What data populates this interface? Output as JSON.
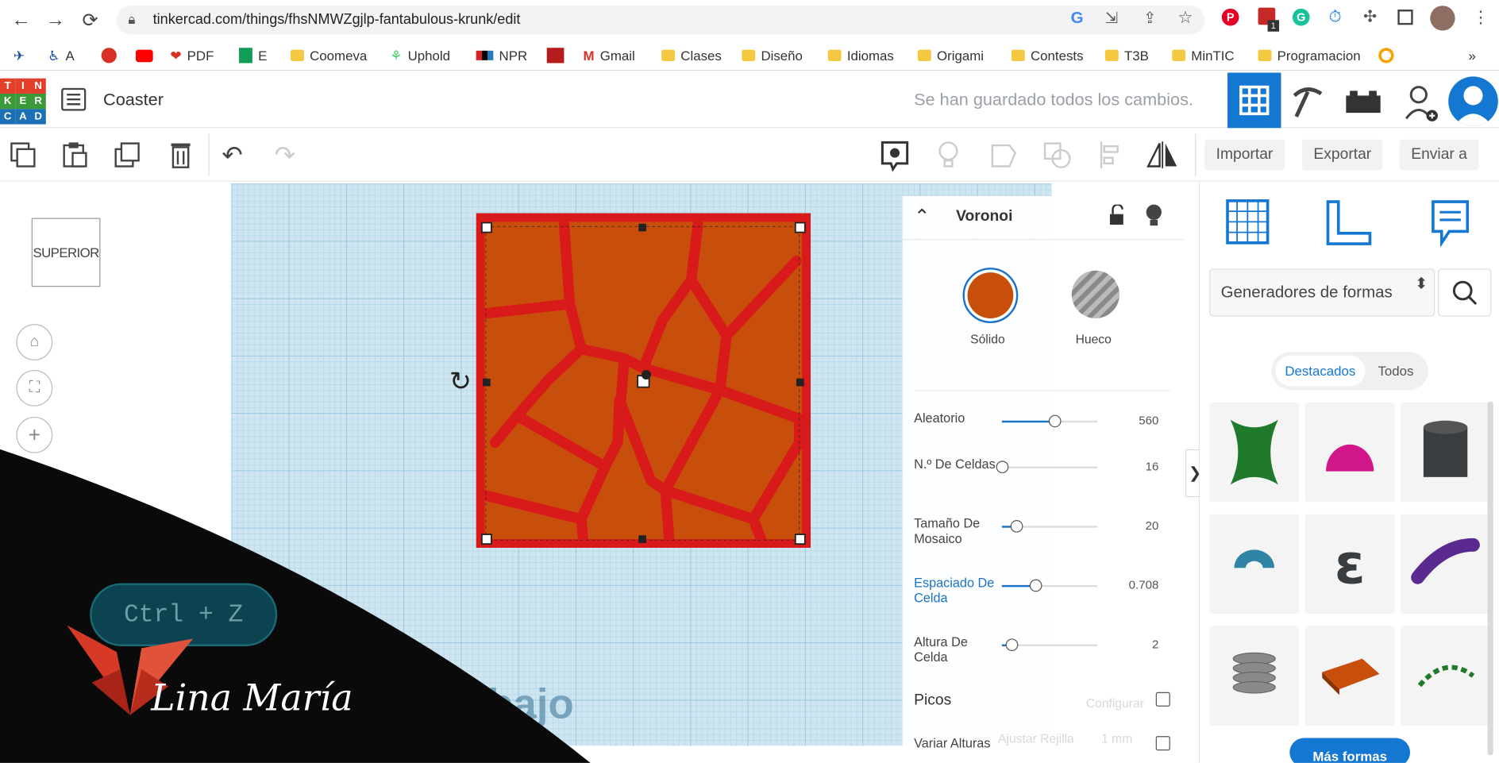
{
  "browser": {
    "url": "tinkercad.com/things/fhsNMWZgjlp-fantabulous-krunk/edit",
    "bookmarks": [
      "A",
      "PDF",
      "E",
      "Coomeva",
      "Uphold",
      "NPR",
      "Gmail",
      "Clases",
      "Diseño",
      "Idiomas",
      "Origami",
      "Contests",
      "T3B",
      "MinTIC",
      "Programacion"
    ],
    "more_bookmarks": "»",
    "badge": "1"
  },
  "app": {
    "logo_letters": [
      "T",
      "I",
      "N",
      "K",
      "E",
      "R",
      "C",
      "A",
      "D"
    ],
    "logo_colors": [
      "#e2402a",
      "#e2402a",
      "#e2402a",
      "#3a9a3a",
      "#3a9a3a",
      "#3a9a3a",
      "#1a6fb5",
      "#1a6fb5",
      "#1a6fb5"
    ],
    "title": "Coaster",
    "save_status": "Se han guardado todos los cambios.",
    "accent": "#1477d1"
  },
  "toolbar": {
    "import": "Importar",
    "export": "Exportar",
    "send": "Enviar a"
  },
  "workspace": {
    "viewcube": "SUPERIOR",
    "workplane_label": "Plano de trabajo",
    "shape_color": "#c84f0b",
    "frame_color": "#d81a1a"
  },
  "inspector": {
    "title": "Voronoi",
    "solid": "Sólido",
    "hole": "Hueco",
    "params": [
      {
        "label": "Aleatorio",
        "value": "560",
        "level": 0.55
      },
      {
        "label": "N.º De Celdas",
        "value": "16",
        "level": 0.0
      },
      {
        "label": "Tamaño De Mosaico",
        "value": "20",
        "level": 0.15
      },
      {
        "label": "Espaciado De Celda",
        "value": "0.708",
        "level": 0.35
      },
      {
        "label": "Altura De Celda",
        "value": "2",
        "level": 0.1
      }
    ],
    "checks": [
      {
        "label": "Picos",
        "checked": false
      },
      {
        "label": "Variar Alturas",
        "checked": false
      }
    ],
    "config_hint": "Configurar",
    "snap_hint": "Ajustar Rejilla",
    "snap_value": "1 mm",
    "collapse": "❯"
  },
  "panel": {
    "category": "Generadores de formas",
    "tab_featured": "Destacados",
    "tab_all": "Todos",
    "more_shapes": "Más formas",
    "shapes": [
      {
        "name": "hourglass-shape",
        "color": "#1f7a2b"
      },
      {
        "name": "dome-shape",
        "color": "#d1168a"
      },
      {
        "name": "cylinder-shape",
        "color": "#3a3d40"
      },
      {
        "name": "torus-shape",
        "color": "#2f85a3"
      },
      {
        "name": "epsilon-shape",
        "color": "#3a3d40"
      },
      {
        "name": "bent-tube-shape",
        "color": "#5a2a90"
      },
      {
        "name": "coin-stack-shape",
        "color": "#8a8a8a"
      },
      {
        "name": "voronoi-tile-shape",
        "color": "#c84f0b"
      },
      {
        "name": "dashed-arc-shape",
        "color": "#1f7a2b"
      }
    ]
  },
  "overlay": {
    "shortcut": "Ctrl + Z",
    "signature": "Lina María"
  }
}
